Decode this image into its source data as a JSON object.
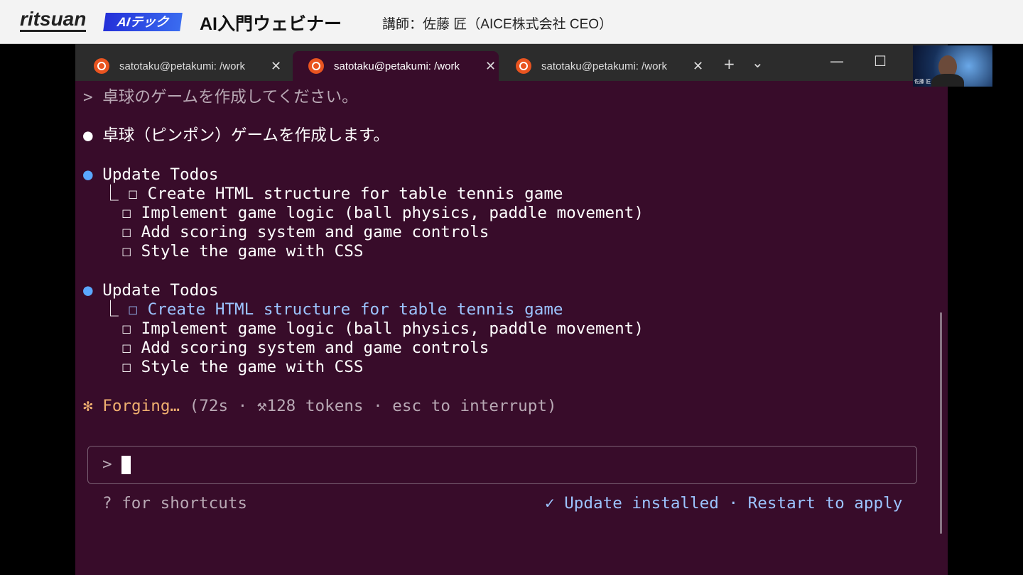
{
  "banner": {
    "logo": "ritsuan",
    "badge": "AIテック",
    "title": "AI入門ウェビナー",
    "subtitle": "講師：佐藤 匠（AICE株式会社 CEO）"
  },
  "tabs": [
    {
      "label": "satotaku@petakumi: /work"
    },
    {
      "label": "satotaku@petakumi: /work"
    },
    {
      "label": "satotaku@petakumi: /work"
    }
  ],
  "tab_controls": {
    "new": "+",
    "dropdown": "⌄",
    "minimize": "—",
    "maximize": "☐",
    "close": "✕"
  },
  "webcam": {
    "name": "佐藤 匠"
  },
  "terminal": {
    "prompt_line": "> 卓球のゲームを作成してください。",
    "reply": "卓球（ピンポン）ゲームを作成します。",
    "bullet": "●",
    "blocks": [
      {
        "title": "Update Todos",
        "items": [
          "Create HTML structure for table tennis game",
          "Implement game logic (ball physics, paddle movement)",
          "Add scoring system and game controls",
          "Style the game with CSS"
        ]
      },
      {
        "title": "Update Todos",
        "items": [
          "Create HTML structure for table tennis game",
          "Implement game logic (ball physics, paddle movement)",
          "Add scoring system and game controls",
          "Style the game with CSS"
        ]
      }
    ],
    "status_star": "✻",
    "status_word": "Forging…",
    "status_detail": "(72s · ⚒128 tokens · esc to interrupt)",
    "input_prompt": ">",
    "shortcuts": "? for shortcuts",
    "update": "✓ Update installed · Restart to apply"
  },
  "colors": {
    "terminal_bg": "#380c2a",
    "accent_blue": "#9cc4ff",
    "status_orange": "#f0b070"
  }
}
